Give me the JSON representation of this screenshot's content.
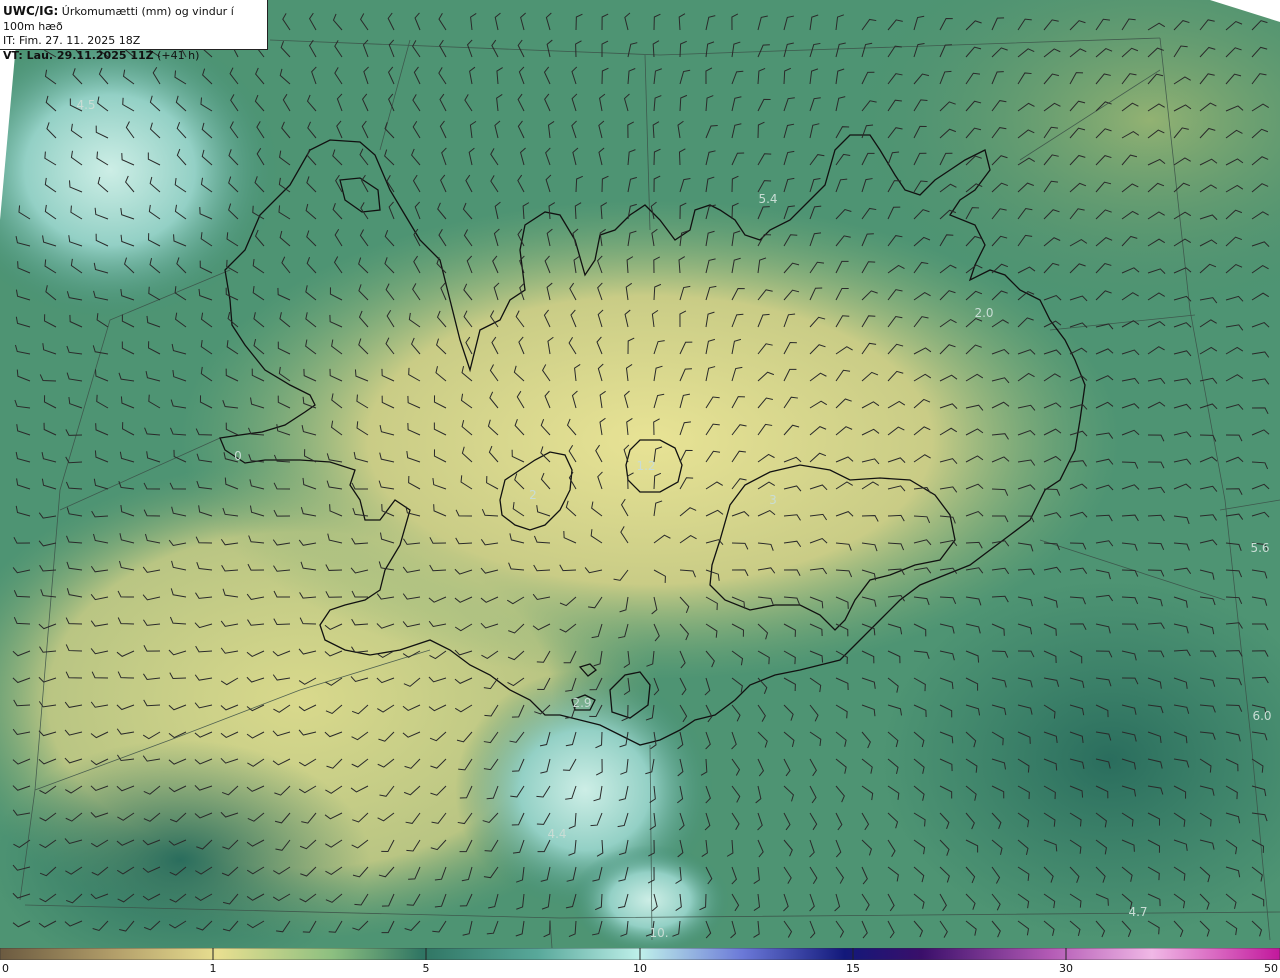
{
  "info": {
    "product": "UWC/IG:",
    "description": "Úrkomumætti (mm) og vindur í 100m hæð",
    "init_time": "IT: Fim. 27. 11. 2025 18Z",
    "valid_prefix": "VT: ",
    "valid_time": "Lau. 29.11.2025 11Z",
    "lead": " (+41 h)"
  },
  "field_labels": [
    "4.5",
    "5.4",
    "2.0",
    "0",
    "1.2",
    "2",
    "3",
    "5.6",
    "2.9",
    "6.0",
    "4.4",
    "4.7",
    "10."
  ],
  "colorbar": {
    "ticks": [
      "0",
      "1",
      "5",
      "10",
      "15",
      "30",
      "50"
    ]
  },
  "colors": {
    "dark_teal": "#2f7563",
    "mid_green": "#4e9473",
    "light_green": "#8fb77a",
    "pale_yellow": "#e3e08e",
    "cyan": "#9ed3cc",
    "barb": "#2a2a2a",
    "coast": "#111111"
  }
}
